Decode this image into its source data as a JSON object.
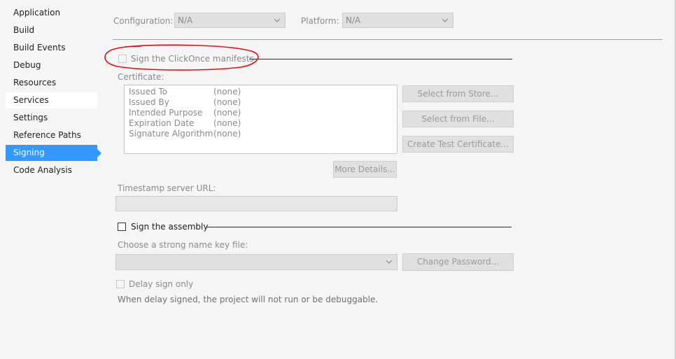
{
  "sidebar": {
    "items": [
      {
        "label": "Application"
      },
      {
        "label": "Build"
      },
      {
        "label": "Build Events"
      },
      {
        "label": "Debug"
      },
      {
        "label": "Resources"
      },
      {
        "label": "Services"
      },
      {
        "label": "Settings"
      },
      {
        "label": "Reference Paths"
      },
      {
        "label": "Signing"
      },
      {
        "label": "Code Analysis"
      }
    ],
    "selected": "Signing",
    "hovered": "Services"
  },
  "config": {
    "configuration_label": "Configuration:",
    "configuration_value": "N/A",
    "platform_label": "Platform:",
    "platform_value": "N/A"
  },
  "clickonce": {
    "checkbox_label": "Sign the ClickOnce manifests",
    "checked": false,
    "certificate_label": "Certificate:",
    "fields": [
      {
        "name": "Issued To",
        "value": "(none)"
      },
      {
        "name": "Issued By",
        "value": "(none)"
      },
      {
        "name": "Intended Purpose",
        "value": "(none)"
      },
      {
        "name": "Expiration Date",
        "value": "(none)"
      },
      {
        "name": "Signature Algorithm",
        "value": "(none)"
      }
    ],
    "select_from_store": "Select from Store...",
    "select_from_file": "Select from File...",
    "create_test_certificate": "Create Test Certificate...",
    "more_details": "More Details...",
    "timestamp_label": "Timestamp server URL:",
    "timestamp_value": ""
  },
  "assembly": {
    "checkbox_label": "Sign the assembly",
    "checked": false,
    "key_file_label": "Choose a strong name key file:",
    "key_file_value": "",
    "change_password": "Change Password...",
    "delay_sign_label": "Delay sign only",
    "delay_sign_checked": false,
    "delay_note": "When delay signed, the project will not run or be debuggable."
  },
  "colors": {
    "accent": "#3399ff",
    "annotation": "#e01010"
  }
}
